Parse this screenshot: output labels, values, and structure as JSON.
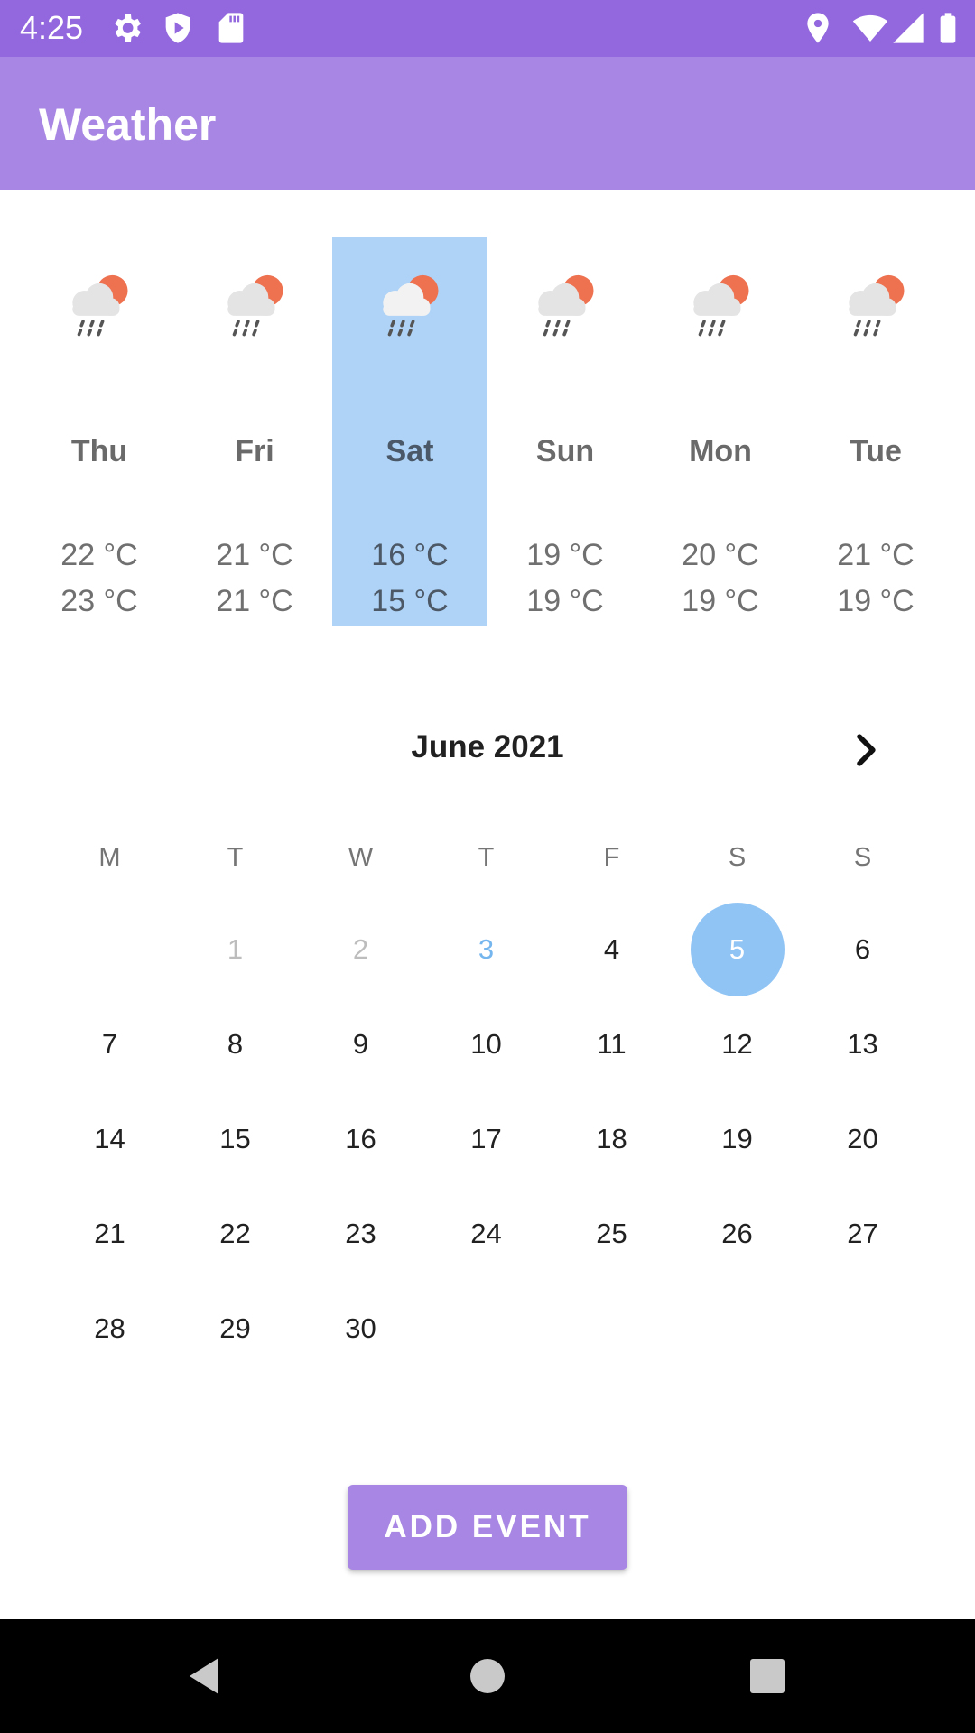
{
  "status": {
    "time": "4:25"
  },
  "app": {
    "title": "Weather"
  },
  "forecast": [
    {
      "day": "Thu",
      "high": "22 °C",
      "low": "23 °C",
      "selected": false
    },
    {
      "day": "Fri",
      "high": "21 °C",
      "low": "21 °C",
      "selected": false
    },
    {
      "day": "Sat",
      "high": "16 °C",
      "low": "15 °C",
      "selected": true
    },
    {
      "day": "Sun",
      "high": "19 °C",
      "low": "19 °C",
      "selected": false
    },
    {
      "day": "Mon",
      "high": "20 °C",
      "low": "19 °C",
      "selected": false
    },
    {
      "day": "Tue",
      "high": "21 °C",
      "low": "19 °C",
      "selected": false
    }
  ],
  "calendar": {
    "month": "June 2021",
    "weekdays": [
      "M",
      "T",
      "W",
      "T",
      "F",
      "S",
      "S"
    ],
    "first_weekday_index": 1,
    "days_in_month": 30,
    "today": 3,
    "selected": 5
  },
  "actions": {
    "add_event": "ADD EVENT"
  },
  "icons": {
    "weather": "cloud-rain-sun-icon",
    "next": "chevron-right-icon",
    "status_left": [
      "settings-icon",
      "shield-icon",
      "sd-card-icon"
    ],
    "status_right": [
      "location-icon",
      "wifi-icon",
      "signal-icon",
      "battery-icon"
    ]
  },
  "colors": {
    "status_bar": "#9368de",
    "app_bar": "#a886e4",
    "selected_day": "#afd3f6",
    "selected_date": "#90c4f5",
    "today_text": "#76b6ee",
    "sun": "#ee7150"
  }
}
